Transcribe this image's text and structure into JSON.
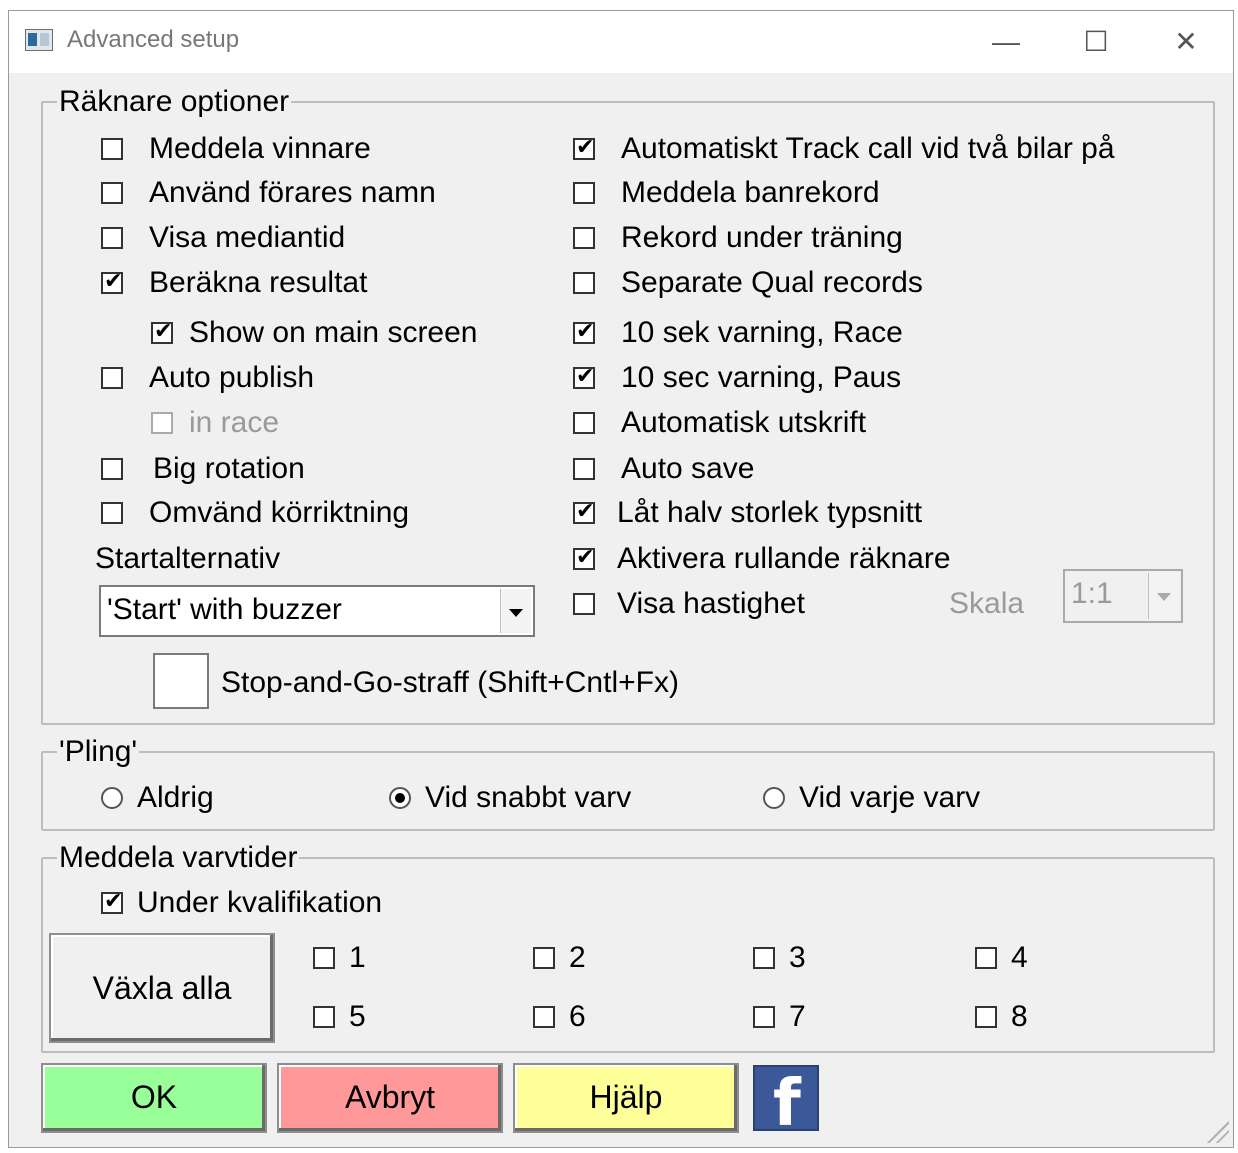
{
  "window": {
    "title": "Advanced setup",
    "minimize": "—",
    "maximize": "☐",
    "close": "✕"
  },
  "counter_options": {
    "legend": "Räknare optioner",
    "left": [
      {
        "label": "Meddela vinnare",
        "checked": false
      },
      {
        "label": "Använd förares namn",
        "checked": false
      },
      {
        "label": "Visa mediantid",
        "checked": false
      },
      {
        "label": "Beräkna resultat",
        "checked": true
      },
      {
        "label": "Show on main screen",
        "checked": true
      },
      {
        "label": "Auto publish",
        "checked": false
      },
      {
        "label": "in race",
        "checked": false,
        "disabled": true
      },
      {
        "label": "Big rotation",
        "checked": false
      },
      {
        "label": "Omvänd körriktning",
        "checked": false
      }
    ],
    "right": [
      {
        "label": "Automatiskt Track call vid två bilar på",
        "checked": true
      },
      {
        "label": "Meddela banrekord",
        "checked": false
      },
      {
        "label": "Rekord under träning",
        "checked": false
      },
      {
        "label": "Separate Qual records",
        "checked": false
      },
      {
        "label": "10 sek varning, Race",
        "checked": true
      },
      {
        "label": "10 sec varning, Paus",
        "checked": true
      },
      {
        "label": "Automatisk utskrift",
        "checked": false
      },
      {
        "label": "Auto save",
        "checked": false
      },
      {
        "label": "Låt halv storlek typsnitt",
        "checked": true
      },
      {
        "label": "Aktivera rullande räknare",
        "checked": true
      },
      {
        "label": "Visa hastighet",
        "checked": false
      }
    ],
    "start_label": "Startalternativ",
    "start_value": "'Start' with buzzer",
    "scale_label": "Skala",
    "scale_value": "1:1",
    "stop_and_go_label": "Stop-and-Go-straff (Shift+Cntl+Fx)"
  },
  "pling": {
    "legend": "'Pling'",
    "options": [
      {
        "label": "Aldrig",
        "selected": false
      },
      {
        "label": "Vid snabbt varv",
        "selected": true
      },
      {
        "label": "Vid varje varv",
        "selected": false
      }
    ]
  },
  "lap_times": {
    "legend": "Meddela varvtider",
    "qualification_label": "Under kvalifikation",
    "qualification_checked": true,
    "toggle_all_label": "Växla alla",
    "lanes": [
      "1",
      "2",
      "3",
      "4",
      "5",
      "6",
      "7",
      "8"
    ]
  },
  "buttons": {
    "ok": "OK",
    "cancel": "Avbryt",
    "help": "Hjälp",
    "facebook": "f"
  },
  "colors": {
    "ok": "#99ff99",
    "cancel": "#ff9999",
    "help": "#ffff99",
    "facebook": "#3b5998"
  }
}
